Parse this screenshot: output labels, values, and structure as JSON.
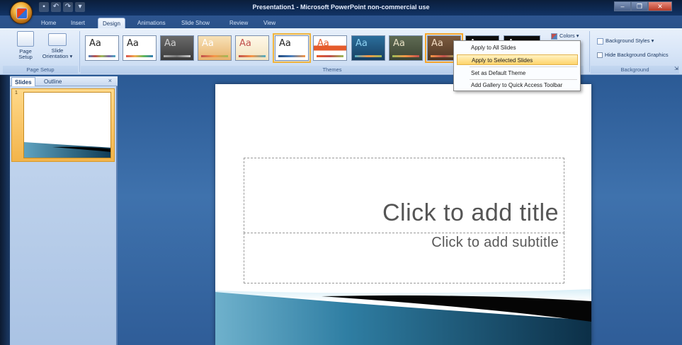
{
  "window": {
    "title": "Presentation1 - Microsoft PowerPoint non-commercial use"
  },
  "ribbon_tabs": [
    "Home",
    "Insert",
    "Design",
    "Animations",
    "Slide Show",
    "Review",
    "View"
  ],
  "active_tab": "Design",
  "page_setup_group": {
    "label": "Page Setup",
    "page_setup_btn": [
      "Page",
      "Setup"
    ],
    "slide_orientation_btn": [
      "Slide",
      "Orientation ▾"
    ]
  },
  "themes_group": {
    "label": "Themes",
    "thumbnail_text": "Aa"
  },
  "colors_btn": "Colors ▾",
  "background_group": {
    "label": "Background",
    "background_styles": "Background Styles ▾",
    "hide_background_graphics": "Hide Background Graphics"
  },
  "context_menu": {
    "items": [
      "Apply to All Slides",
      "Apply to Selected Slides",
      "Set as Default Theme",
      "Add Gallery to Quick Access Toolbar"
    ],
    "highlighted_index": 1
  },
  "slides_panel": {
    "tabs": [
      "Slides",
      "Outline"
    ],
    "close": "×",
    "slide_number": "1"
  },
  "slide": {
    "title_placeholder": "Click to add title",
    "subtitle_placeholder": "Click to add subtitle"
  },
  "colors": {
    "accent_selection": "#f5a52a",
    "menu_highlight": "#ffd46b",
    "slide_wave_dark": "#0e3a54",
    "slide_wave_light": "#5fa3c0"
  }
}
